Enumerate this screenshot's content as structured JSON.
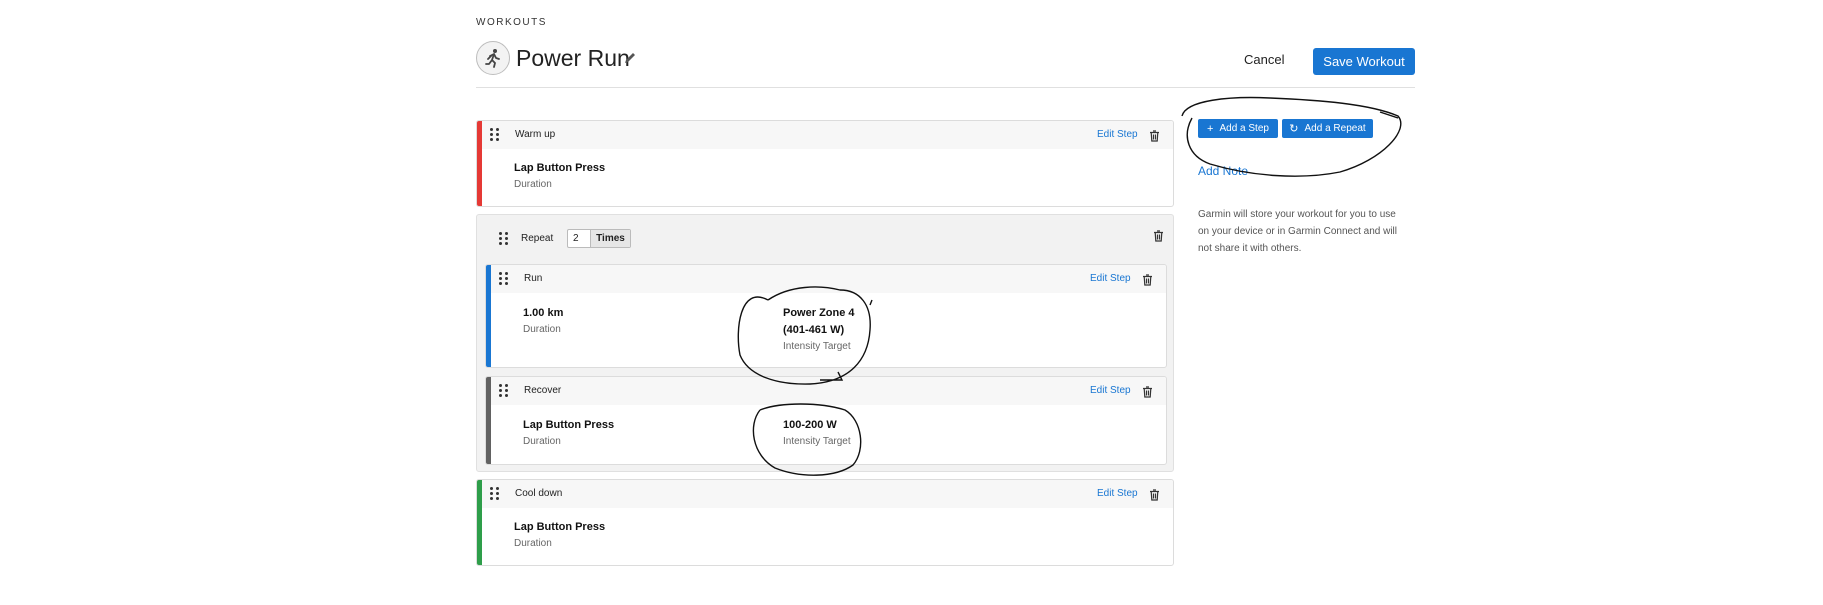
{
  "header": {
    "section_label": "WORKOUTS",
    "workout_name": "Power Run",
    "cancel_label": "Cancel",
    "save_label": "Save Workout"
  },
  "steps": {
    "warmup": {
      "type": "Warm up",
      "edit_label": "Edit Step",
      "duration_value": "Lap Button Press",
      "duration_label": "Duration",
      "color": "#e53935"
    },
    "repeat": {
      "label": "Repeat",
      "count": "2",
      "times_label": "Times",
      "run": {
        "type": "Run",
        "edit_label": "Edit Step",
        "color": "#1976d2",
        "duration_value": "1.00 km",
        "duration_label": "Duration",
        "target_line1": "Power Zone 4",
        "target_line2": "(401-461 W)",
        "target_label": "Intensity Target"
      },
      "recover": {
        "type": "Recover",
        "edit_label": "Edit Step",
        "color": "#616161",
        "duration_value": "Lap Button Press",
        "duration_label": "Duration",
        "target_value": "100-200 W",
        "target_label": "Intensity Target"
      }
    },
    "cooldown": {
      "type": "Cool down",
      "edit_label": "Edit Step",
      "duration_value": "Lap Button Press",
      "duration_label": "Duration",
      "color": "#2e9e4a"
    }
  },
  "sidebar": {
    "add_step_label": "Add a Step",
    "add_repeat_label": "Add a Repeat",
    "add_note_label": "Add Note",
    "info_text": "Garmin will store your workout for you to use on your device or in Garmin Connect and will not share it with others."
  },
  "colors": {
    "accent": "#1976d2"
  },
  "icons": [
    "runner-icon",
    "pencil-icon",
    "drag-handle-icon",
    "trash-icon",
    "plus-icon",
    "repeat-icon"
  ]
}
